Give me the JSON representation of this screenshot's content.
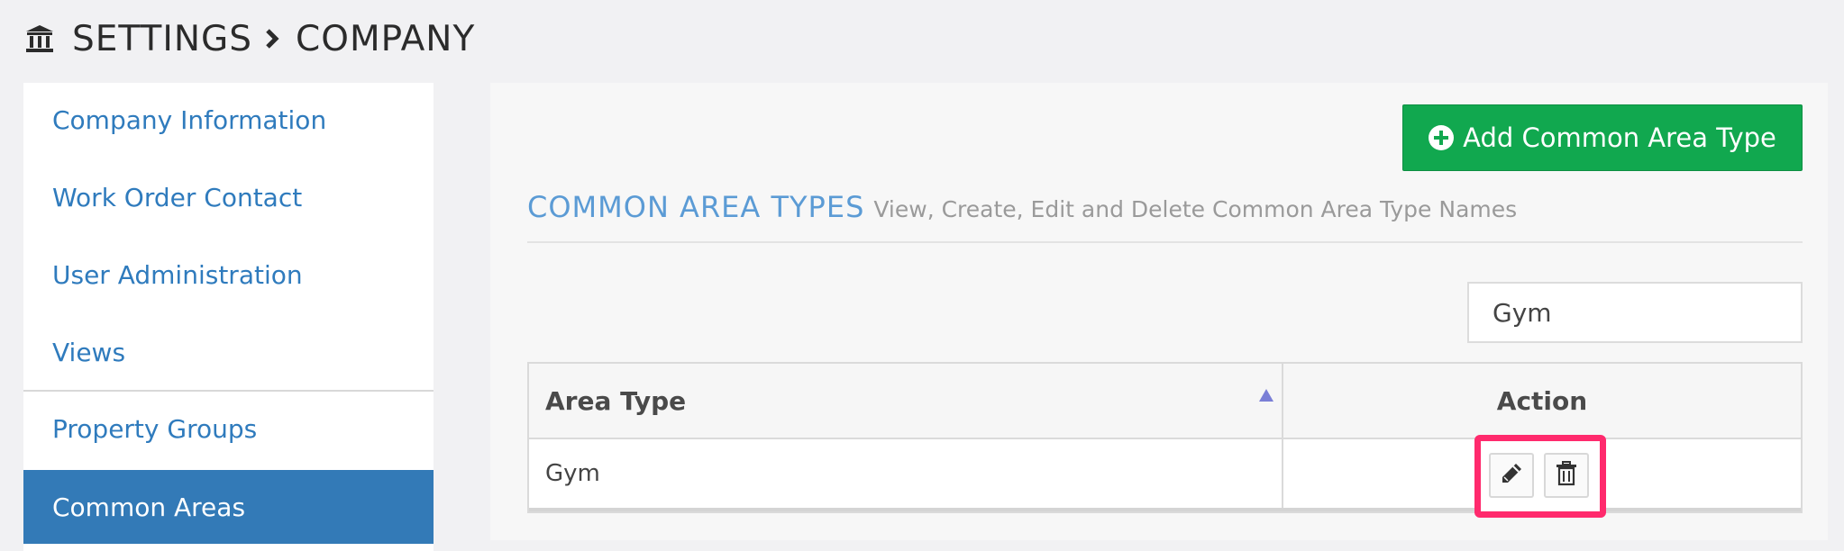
{
  "breadcrumb": {
    "icon": "bank-icon",
    "settings": "SETTINGS",
    "company": "COMPANY"
  },
  "sidebar": {
    "items": [
      {
        "label": "Company Information",
        "active": false
      },
      {
        "label": "Work Order Contact",
        "active": false
      },
      {
        "label": "User Administration",
        "active": false
      },
      {
        "label": "Views",
        "active": false
      },
      {
        "label": "Property Groups",
        "active": false
      },
      {
        "label": "Common Areas",
        "active": true
      }
    ]
  },
  "main": {
    "add_button_label": "Add Common Area Type",
    "section_title": "COMMON AREA TYPES",
    "section_subtitle": "View, Create, Edit and Delete Common Area Type Names",
    "search_value": "Gym",
    "table": {
      "columns": [
        "Area Type",
        "Action"
      ],
      "sort": "ascending",
      "rows": [
        {
          "area_type": "Gym",
          "actions": [
            "edit-icon",
            "trash-icon"
          ]
        }
      ]
    }
  },
  "colors": {
    "accent_blue": "#337ab7",
    "link_blue": "#2f7bbd",
    "title_blue": "#5b9bd5",
    "add_green": "#11a84f",
    "highlight_pink": "#ff2a6d"
  }
}
